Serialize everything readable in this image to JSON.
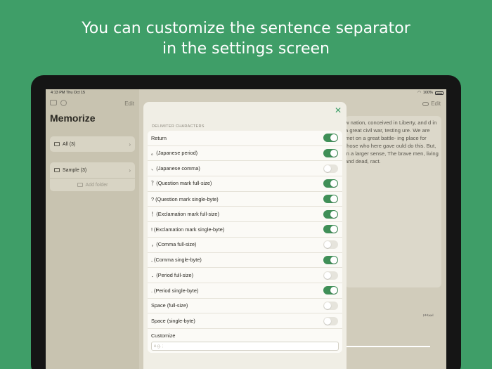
{
  "headline": {
    "line1": "You can customize the sentence separator",
    "line2": "in the settings screen"
  },
  "statusbar": {
    "time": "4:13 PM   Thu Oct 15",
    "battery": "100%"
  },
  "sidebar": {
    "edit_label": "Edit",
    "title": "Memorize",
    "folders": [
      {
        "label": "All  (3)"
      },
      {
        "label": "Sample  (3)"
      }
    ],
    "add_folder_label": "Add folder"
  },
  "main": {
    "edit_label": "Edit",
    "text_excerpt": "w nation, conceived in Liberty, and d in a great civil war, testing ure. We are met on a great battle- ing place for those who here gave ould do this. But, in a larger sense, The brave men, living and dead, ract.",
    "playback_icons": "⏮ ⏭"
  },
  "settings": {
    "section_title": "DELIMITER CHARACTERS",
    "rows": [
      {
        "label": "Return",
        "on": true
      },
      {
        "label": "。(Japanese period)",
        "on": true
      },
      {
        "label": "、(Japanese comma)",
        "on": false
      },
      {
        "label": "？(Question mark full-size)",
        "on": true
      },
      {
        "label": "? (Question mark single-byte)",
        "on": true
      },
      {
        "label": "！(Exclamation mark full-size)",
        "on": true
      },
      {
        "label": "! (Exclamation mark single-byte)",
        "on": true
      },
      {
        "label": "，(Comma full-size)",
        "on": false
      },
      {
        "label": ", (Comma single-byte)",
        "on": true
      },
      {
        "label": "．(Period full-size)",
        "on": false
      },
      {
        "label": ". (Period single-byte)",
        "on": true
      },
      {
        "label": "Space (full-size)",
        "on": false
      },
      {
        "label": "Space (single-byte)",
        "on": false
      }
    ],
    "customize_label": "Customize",
    "customize_placeholder": "e.g. ;"
  },
  "colors": {
    "background": "#3f9e68",
    "toggle_on": "#3f8f57",
    "toggle_off": "#e6e4dc"
  }
}
